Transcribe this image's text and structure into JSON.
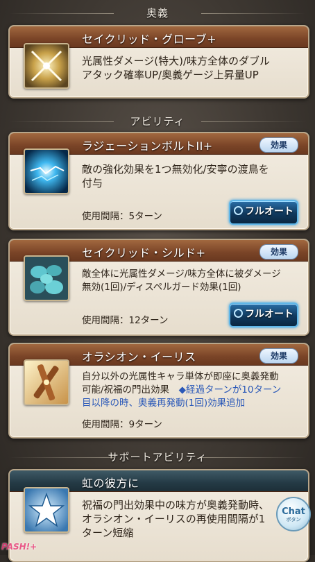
{
  "sections": {
    "ougi": "奥義",
    "ability": "アビリティ",
    "support": "サポートアビリティ"
  },
  "ougi_card": {
    "title": "セイクリッド・グローブ+",
    "desc_line1": "光属性ダメージ(特大)/味方全体のダブル",
    "desc_line2": "アタック確率UP/奥義ゲージ上昇量UP",
    "icon": "crossed-swords-icon"
  },
  "abilities": [
    {
      "title": "ラジェーションボルトII+",
      "effect_label": "効果",
      "desc_line1": "敵の強化効果を1つ無効化/安寧の渡鳥を",
      "desc_line2": "付与",
      "cooldown": "使用間隔：5ターン",
      "fullauto_label": "フルオート",
      "icon": "lightning-burst-icon"
    },
    {
      "title": "セイクリッド・シルド+",
      "effect_label": "効果",
      "desc_line1": "敵全体に光属性ダメージ/味方全体に被ダメージ",
      "desc_line2": "無効(1回)/ディスペルガード効果(1回)",
      "cooldown": "使用間隔：12ターン",
      "fullauto_label": "フルオート",
      "icon": "stones-icon"
    },
    {
      "title": "オラシオン・イーリス",
      "effect_label": "効果",
      "desc_line1": "自分以外の光属性キャラ単体が即座に奥義発動",
      "desc_line2a": "可能/祝福の門出効果　",
      "desc_line2b": "◆経過ターンが10ターン",
      "desc_line3": "目以降の時、奥義再発動(1回)効果追加",
      "cooldown": "使用間隔：9ターン",
      "icon": "crossed-swords-gold-icon"
    }
  ],
  "support_card": {
    "title": "虹の彼方に",
    "desc_line1": "祝福の門出効果中の味方が奥義発動時、",
    "desc_line2": "オラシオン・イーリスの再使用間隔が1",
    "desc_line3": "ターン短縮",
    "icon": "star-icon"
  },
  "chat": {
    "label": "Chat",
    "sub": "ボタン"
  },
  "watermark": "PASH!+"
}
